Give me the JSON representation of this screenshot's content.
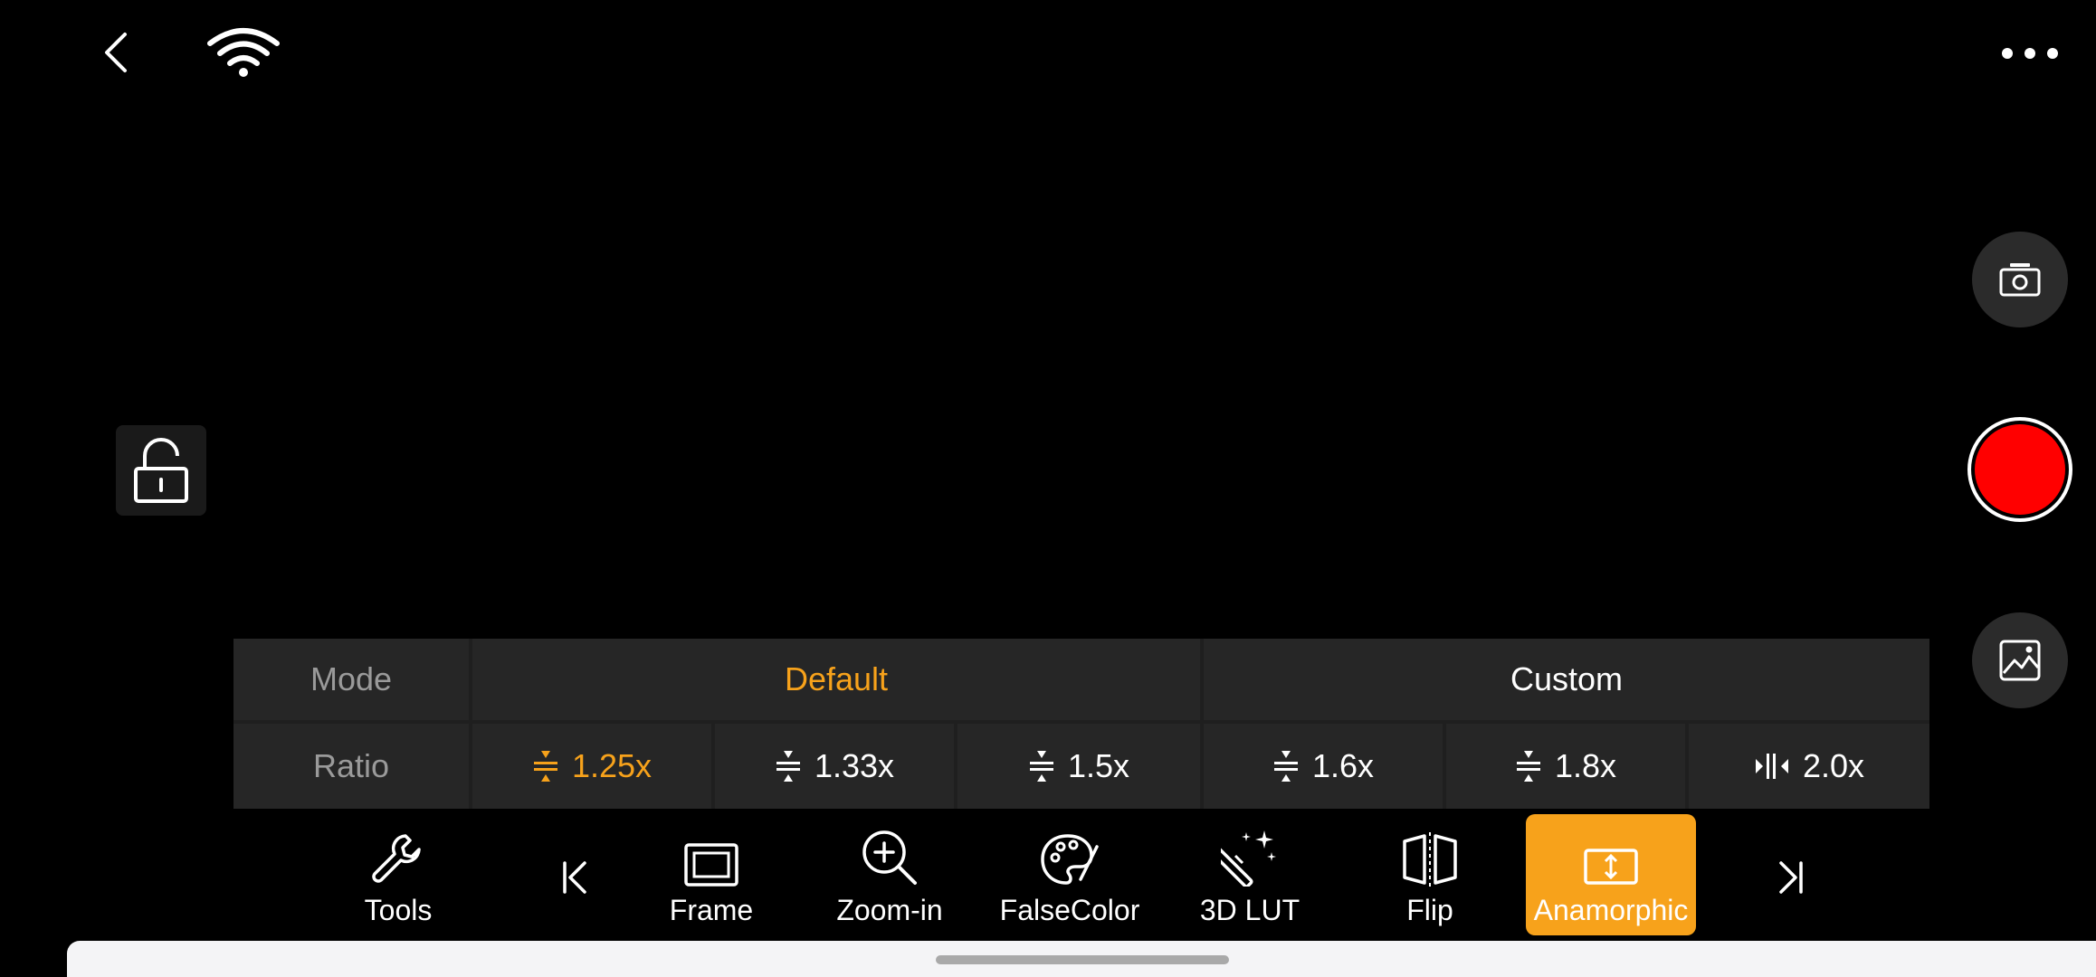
{
  "top_bar": {
    "back_icon": "chevron-left-icon",
    "wifi_icon": "wifi-icon",
    "more_icon": "more-horizontal-icon"
  },
  "side": {
    "lock_icon": "unlock-icon",
    "snapshot_icon": "camera-icon",
    "record_icon": "record-icon",
    "gallery_icon": "gallery-icon"
  },
  "panel": {
    "mode_label": "Mode",
    "ratio_label": "Ratio",
    "modes": [
      {
        "label": "Default",
        "active": true
      },
      {
        "label": "Custom",
        "active": false
      }
    ],
    "ratios": [
      {
        "label": "1.25x",
        "icon": "vertical-squeeze-icon",
        "active": true
      },
      {
        "label": "1.33x",
        "icon": "vertical-squeeze-icon",
        "active": false
      },
      {
        "label": "1.5x",
        "icon": "vertical-squeeze-icon",
        "active": false
      },
      {
        "label": "1.6x",
        "icon": "vertical-squeeze-icon",
        "active": false
      },
      {
        "label": "1.8x",
        "icon": "vertical-squeeze-icon",
        "active": false
      },
      {
        "label": "2.0x",
        "icon": "horizontal-squeeze-icon",
        "active": false
      }
    ]
  },
  "toolbar": {
    "tools_label": "Tools",
    "items": [
      {
        "label": "Frame",
        "icon": "frame-icon",
        "active": false
      },
      {
        "label": "Zoom-in",
        "icon": "zoom-in-icon",
        "active": false
      },
      {
        "label": "FalseColor",
        "icon": "palette-icon",
        "active": false
      },
      {
        "label": "3D LUT",
        "icon": "magic-wand-icon",
        "active": false
      },
      {
        "label": "Flip",
        "icon": "flip-icon",
        "active": false
      },
      {
        "label": "Anamorphic",
        "icon": "anamorphic-icon",
        "active": true
      }
    ],
    "prev_icon": "skip-start-icon",
    "next_icon": "skip-end-icon"
  },
  "colors": {
    "accent": "#f7a21b",
    "record": "#ff0000",
    "background": "#000000",
    "panel_cell": "#262626"
  }
}
